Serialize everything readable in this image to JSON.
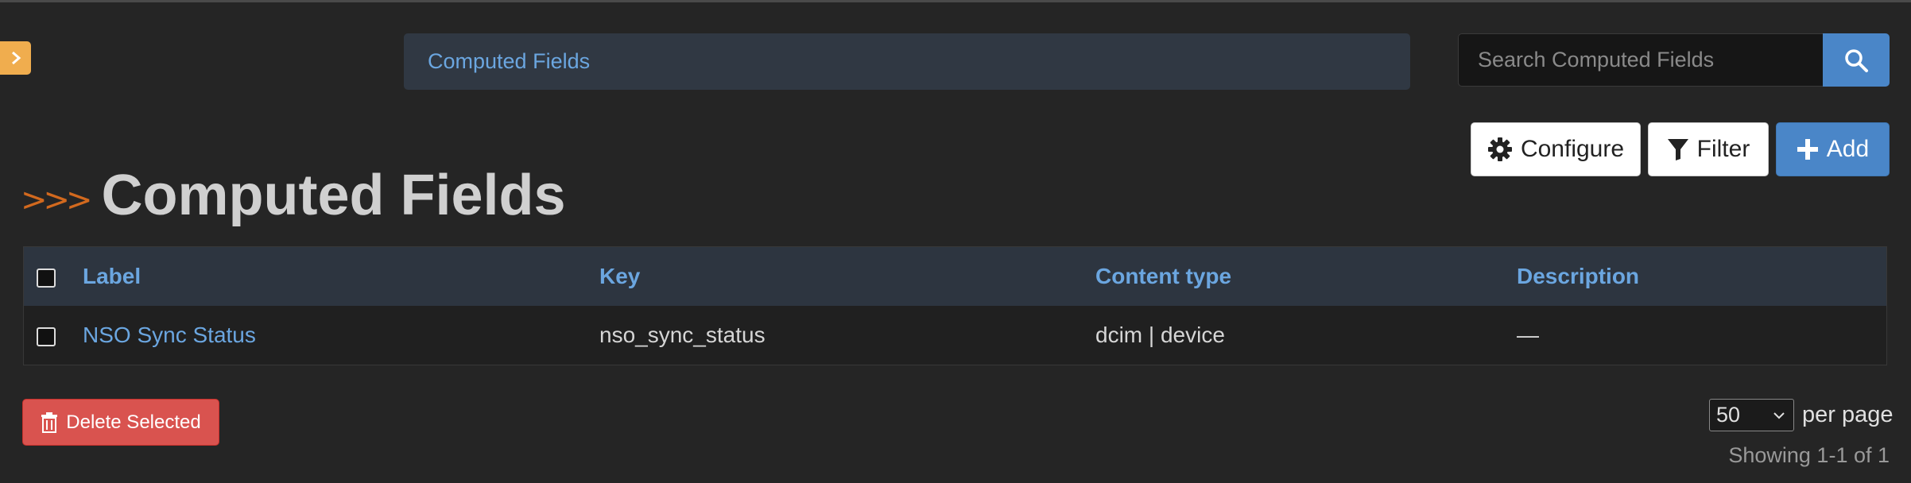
{
  "breadcrumb": {
    "label": "Computed Fields"
  },
  "search": {
    "placeholder": "Search Computed Fields"
  },
  "actions": {
    "configure": "Configure",
    "filter": "Filter",
    "add": "Add"
  },
  "page": {
    "title": "Computed Fields"
  },
  "table": {
    "headers": [
      "Label",
      "Key",
      "Content type",
      "Description"
    ],
    "rows": [
      {
        "label": "NSO Sync Status",
        "key": "nso_sync_status",
        "content_type": "dcim | device",
        "description": "—"
      }
    ]
  },
  "footer": {
    "delete_label": "Delete Selected",
    "per_page_value": "50",
    "per_page_label": "per page",
    "showing": "Showing 1-1 of 1"
  },
  "colors": {
    "accent": "#4a86c8",
    "link": "#6ba6e0",
    "danger": "#d9534f",
    "toggle": "#f0ad4e"
  },
  "icons": [
    "chevron-right-icon",
    "search-icon",
    "gear-icon",
    "filter-icon",
    "plus-icon",
    "trash-icon",
    "chevron-down-icon"
  ]
}
